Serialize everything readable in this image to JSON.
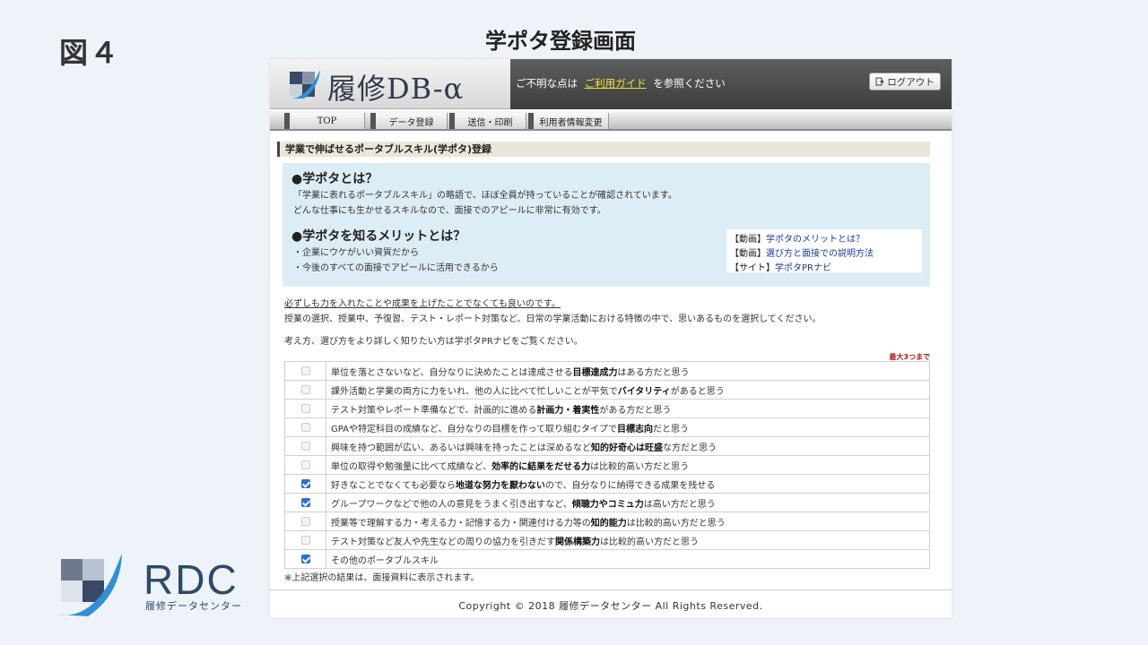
{
  "slide": {
    "fig_label": "図４",
    "title": "学ポタ登録画面"
  },
  "brand": {
    "rdc_text": "RDC",
    "rdc_sub": "履修データセンター"
  },
  "app": {
    "logo_text": "履修DB-α",
    "header_msg_pre": "ご不明な点は",
    "header_guide_link": "ご利用ガイド",
    "header_msg_post": "を参照ください",
    "logout_label": "ログアウト",
    "nav": [
      "TOP",
      "データ登録",
      "送信・印刷",
      "利用者情報変更"
    ],
    "section_title": "学業で伸ばせるポータブルスキル(学ポタ)登録",
    "info": {
      "h1": "●学ポタとは？",
      "p1": "「学業に表れるポータブルスキル」の略語で、ほぼ全員が持っていることが確認されています。",
      "p2": "どんな仕事にも生かせるスキルなので、面接でのアピールに非常に有効です。",
      "h2": "●学ポタを知るメリットとは？",
      "p3": "・企業にウケがいい資質だから",
      "p4": "・今後のすべての面接でアピールに活用できるから",
      "links": [
        {
          "tag": "【動画】",
          "text": "学ポタのメリットとは？"
        },
        {
          "tag": "【動画】",
          "text": "選び方と面接での説明方法"
        },
        {
          "tag": "【サイト】",
          "text": "学ポタPRナビ"
        }
      ]
    },
    "para_underlined": "必ずしも力を入れたことや成果を上げたことでなくても良いのです。",
    "para_1": "授業の選択、授業中、予復習、テスト・レポート対策など、日常の学業活動における特徴の中で、思いあるものを選択してください。",
    "para_2": "考え方、選び方をより詳しく知りたい方は学ポタPRナビをご覧ください。",
    "max_note": "最大3つまで",
    "skills": [
      {
        "pre": "単位を落とさないなど、自分なりに決めたことは達成させる",
        "bold": "目標達成力",
        "post": "はある方だと思う",
        "checked": false
      },
      {
        "pre": "課外活動と学業の両方に力をいれ、他の人に比べて忙しいことが平気で",
        "bold": "バイタリティ",
        "post": "があると思う",
        "checked": false
      },
      {
        "pre": "テスト対策やレポート準備などで、計画的に進める",
        "bold": "計画力・着実性",
        "post": "がある方だと思う",
        "checked": false
      },
      {
        "pre": "GPAや特定科目の成績など、自分なりの目標を作って取り組むタイプで",
        "bold": "目標志向",
        "post": "だと思う",
        "checked": false
      },
      {
        "pre": "興味を持つ範囲が広い、あるいは興味を持ったことは深めるなど",
        "bold": "知的好奇心は旺盛",
        "post": "な方だと思う",
        "checked": false
      },
      {
        "pre": "単位の取得や勉強量に比べて成績など、",
        "bold": "効率的に結果をだせる力",
        "post": "は比較的高い方だと思う",
        "checked": false
      },
      {
        "pre": "好きなことでなくても必要なら",
        "bold": "地道な努力を厭わない",
        "post": "ので、自分なりに納得できる成果を残せる",
        "checked": true
      },
      {
        "pre": "グループワークなどで他の人の意見をうまく引き出すなど、",
        "bold": "傾聴力やコミュ力",
        "post": "は高い方だと思う",
        "checked": true
      },
      {
        "pre": "授業等で理解する力・考える力・記憶する力・関連付ける力等の",
        "bold": "知的能力",
        "post": "は比較的高い方だと思う",
        "checked": false
      },
      {
        "pre": "テスト対策など友人や先生などの周りの協力を引きだす",
        "bold": "関係構築力",
        "post": "は比較的高い方だと思う",
        "checked": false
      },
      {
        "pre": "その他のポータブルスキル",
        "bold": "",
        "post": "",
        "checked": true
      }
    ],
    "footnote": "※上記選択の結果は、面接資料に表示されます。",
    "copyright": "Copyright © 2018 履修データセンター All Rights Reserved."
  },
  "colors": {
    "accent_blue": "#2b6fd6",
    "info_bg": "#dcedf6",
    "guide_link": "#f2e23a",
    "max_note": "#a81c1c"
  }
}
